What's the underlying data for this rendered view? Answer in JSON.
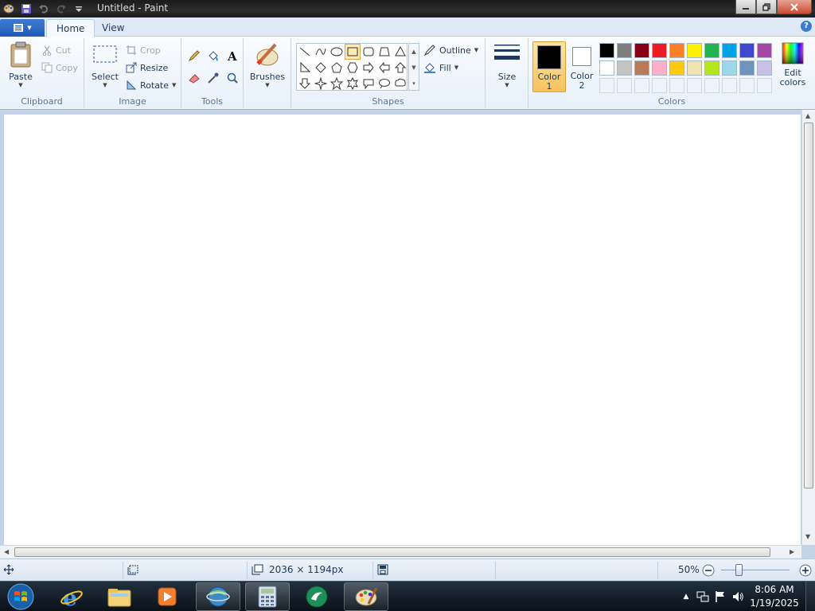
{
  "window": {
    "title": "Untitled - Paint"
  },
  "tabs": [
    {
      "label": "Home"
    },
    {
      "label": "View"
    }
  ],
  "ribbon": {
    "clipboard": {
      "label": "Clipboard",
      "paste": "Paste",
      "cut": "Cut",
      "copy": "Copy"
    },
    "image": {
      "label": "Image",
      "select": "Select",
      "crop": "Crop",
      "resize": "Resize",
      "rotate": "Rotate"
    },
    "tools": {
      "label": "Tools"
    },
    "brushes": {
      "label": "Brushes"
    },
    "shapes": {
      "label": "Shapes",
      "outline": "Outline",
      "fill": "Fill"
    },
    "size": {
      "label": "Size"
    },
    "colors": {
      "label": "Colors",
      "color1_line1": "Color",
      "color1_line2": "1",
      "color2_line1": "Color",
      "color2_line2": "2",
      "edit_line1": "Edit",
      "edit_line2": "colors",
      "color1_value": "#000000",
      "color2_value": "#ffffff",
      "row1": [
        "#000000",
        "#7f7f7f",
        "#880015",
        "#ed1c24",
        "#ff7f27",
        "#fff200",
        "#22b14c",
        "#00a2e8",
        "#3f48cc",
        "#a349a4"
      ],
      "row2": [
        "#ffffff",
        "#c3c3c3",
        "#b97a57",
        "#ffaec9",
        "#ffc90e",
        "#efe4b0",
        "#b5e61d",
        "#99d9ea",
        "#7092be",
        "#c8bfe7"
      ]
    }
  },
  "status": {
    "dimensions": "2036 × 1194px",
    "zoom": "50%"
  },
  "taskbar": {
    "time": "8:06 AM",
    "date": "1/19/2025"
  }
}
